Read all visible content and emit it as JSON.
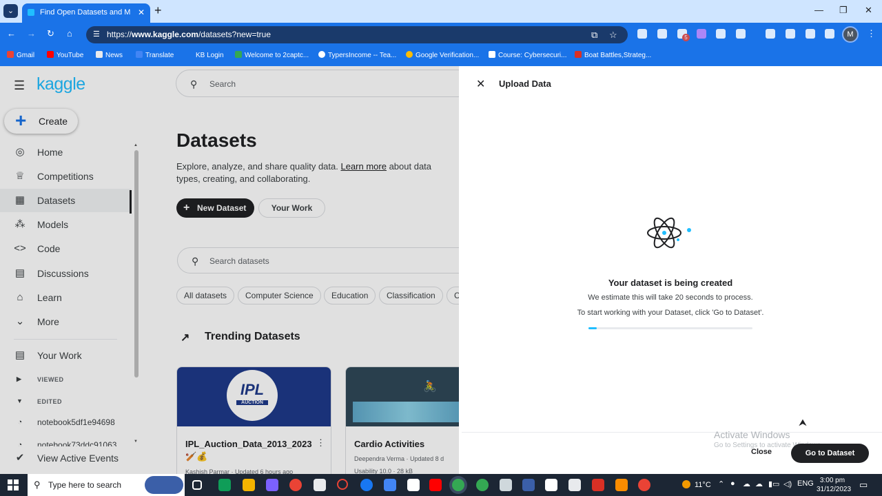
{
  "browser": {
    "tab_title": "Find Open Datasets and Mach",
    "tab_close": "✕",
    "new_tab": "+",
    "url_prefix": "https://",
    "url_host": "www.kaggle.com",
    "url_path": "/datasets?new=true",
    "avatar_letter": "M",
    "ext_badge": "5",
    "bookmarks": [
      "Gmail",
      "YouTube",
      "News",
      "Translate",
      "KB Login",
      "Welcome to 2captc...",
      "TypersIncome -- Tea...",
      "Google Verification...",
      "Course: Cybersecuri...",
      "Boat Battles,Strateg..."
    ],
    "accent": "#1a73e8"
  },
  "kaggle": {
    "logo": "kaggle",
    "create_label": "Create",
    "search_placeholder": "Search",
    "nav": [
      {
        "label": "Home",
        "icon": "compass-icon"
      },
      {
        "label": "Competitions",
        "icon": "trophy-icon"
      },
      {
        "label": "Datasets",
        "icon": "table-icon"
      },
      {
        "label": "Models",
        "icon": "models-icon"
      },
      {
        "label": "Code",
        "icon": "code-icon"
      },
      {
        "label": "Discussions",
        "icon": "discussion-icon"
      },
      {
        "label": "Learn",
        "icon": "learn-icon"
      },
      {
        "label": "More",
        "icon": "chevron-down-icon"
      }
    ],
    "your_work": "Your Work",
    "viewed_label": "VIEWED",
    "edited_label": "EDITED",
    "notebooks": [
      "notebook5df1e94698",
      "notebook73ddc91063"
    ],
    "view_events": "View Active Events",
    "page_title": "Datasets",
    "desc_pre": "Explore, analyze, and share quality data. ",
    "desc_link": "Learn more",
    "desc_post": " about data types, creating, and collaborating.",
    "new_dataset": "New Dataset",
    "your_work_btn": "Your Work",
    "dataset_search_placeholder": "Search datasets",
    "chips": [
      "All datasets",
      "Computer Science",
      "Education",
      "Classification",
      "C"
    ],
    "trending_title": "Trending Datasets",
    "cards": [
      {
        "title": "IPL_Auction_Data_2013_2023",
        "emoji": "🏏💰",
        "meta": "Kashish Parmar · Updated 6 hours ago",
        "img_text": "IPL",
        "img_sub": "AUCTION"
      },
      {
        "title": "Cardio Activities",
        "meta": "Deependra Verma · Updated 8 d",
        "meta2": "Usability 10.0 · 28 kB"
      }
    ]
  },
  "upload": {
    "title": "Upload Data",
    "heading": "Your dataset is being created",
    "estimate": "We estimate this will take 20 seconds to process.",
    "instruction": "To start working with your Dataset, click 'Go to Dataset'.",
    "progress": 0.05,
    "close_label": "Close",
    "goto_label": "Go to Dataset"
  },
  "windows": {
    "watermark_title": "Activate Windows",
    "watermark_sub": "Go to Settings to activate Windows.",
    "search_placeholder": "Type here to search",
    "temperature": "11°C",
    "lang": "ENG",
    "time": "3:00 pm",
    "date": "31/12/2023"
  }
}
